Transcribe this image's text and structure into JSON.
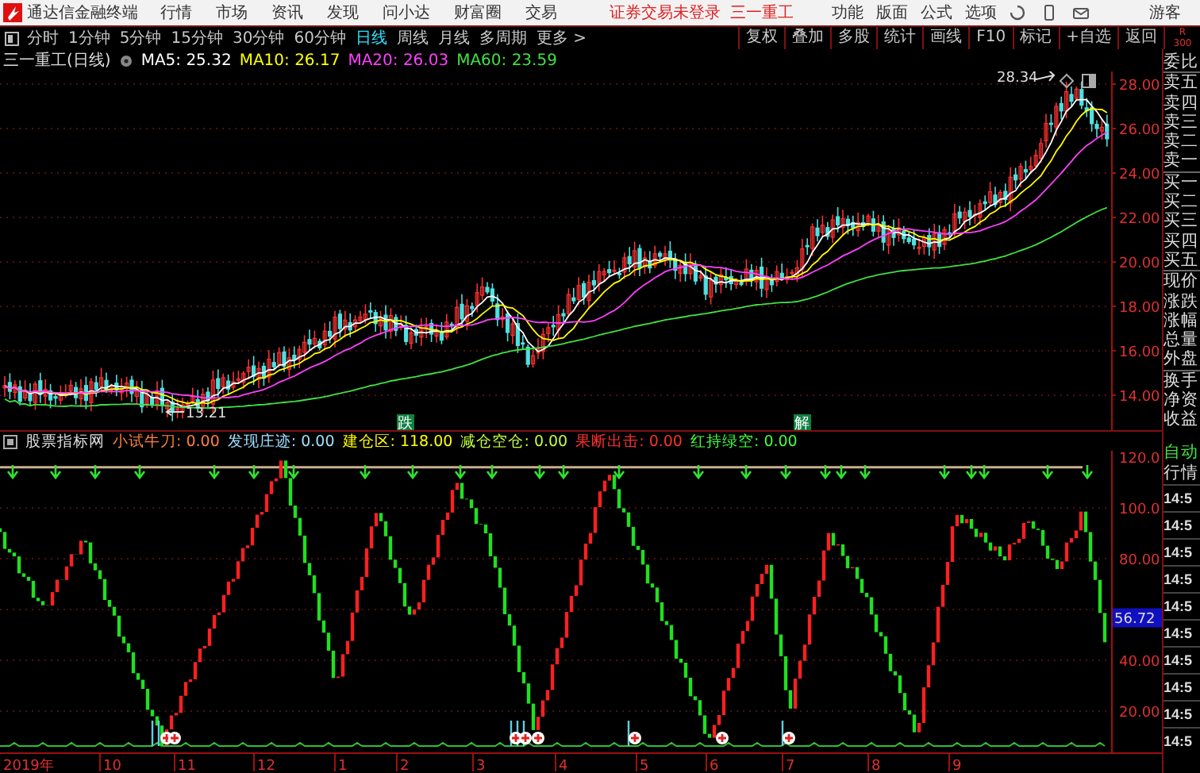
{
  "app": {
    "title": "通达信金融终端",
    "menu": [
      "行情",
      "市场",
      "资讯",
      "发现",
      "问小达",
      "财富圈",
      "交易"
    ],
    "notice": "证券交易未登录",
    "stock": "三一重工",
    "right_menu": [
      "功能",
      "版面",
      "公式",
      "选项"
    ],
    "user": "游客"
  },
  "periods": [
    {
      "label": "分时",
      "selected": false
    },
    {
      "label": "1分钟",
      "selected": false
    },
    {
      "label": "5分钟",
      "selected": false
    },
    {
      "label": "15分钟",
      "selected": false
    },
    {
      "label": "30分钟",
      "selected": false
    },
    {
      "label": "60分钟",
      "selected": false
    },
    {
      "label": "日线",
      "selected": true
    },
    {
      "label": "周线",
      "selected": false
    },
    {
      "label": "月线",
      "selected": false
    },
    {
      "label": "多周期",
      "selected": false
    },
    {
      "label": "更多 >",
      "selected": false
    }
  ],
  "tools": [
    "复权",
    "叠加",
    "多股",
    "统计",
    "画线",
    "F10",
    "标记",
    "+自选",
    "返回"
  ],
  "corner": [
    "R",
    "300"
  ],
  "chart": {
    "title": "三一重工(日线)",
    "ma": [
      {
        "label": "MA5: 25.32",
        "color": "#ffffff"
      },
      {
        "label": "MA10: 26.17",
        "color": "#ffff00"
      },
      {
        "label": "MA20: 26.03",
        "color": "#ff40ff"
      },
      {
        "label": "MA60: 23.59",
        "color": "#40e040"
      }
    ],
    "price_ticks": [
      "28.00",
      "26.00",
      "24.00",
      "22.00",
      "20.00",
      "18.00",
      "16.00",
      "14.00"
    ],
    "high_label": "28.34",
    "low_label": "13.21",
    "event_tags": [
      "跌",
      "解"
    ]
  },
  "indicator": {
    "name": "股票指标网",
    "lines": [
      {
        "label": "小试牛刀: 0.00",
        "color": "#ff8040"
      },
      {
        "label": "发现庄迹: 0.00",
        "color": "#a0e0ff"
      },
      {
        "label": "建仓区: 118.00",
        "color": "#ffff00"
      },
      {
        "label": "减仓空仓: 0.00",
        "color": "#c0ff40"
      },
      {
        "label": "果断出击: 0.00",
        "color": "#ff3030"
      },
      {
        "label": "红持绿空: 0.00",
        "color": "#40ff40"
      }
    ],
    "ticks": [
      "120.0",
      "100.0",
      "80.00",
      "40.00",
      "20.00"
    ],
    "current": "56.72"
  },
  "dates": [
    "2019年",
    "10",
    "11",
    "12",
    "1",
    "2",
    "3",
    "4",
    "5",
    "6",
    "7",
    "8",
    "9"
  ],
  "sidebar": {
    "quote_labels": [
      "委比",
      "卖五",
      "卖四",
      "卖三",
      "卖二",
      "卖一",
      "买一",
      "买二",
      "买三",
      "买四",
      "买五",
      "现价",
      "涨跌",
      "涨幅",
      "总量",
      "外盘",
      "换手",
      "净资",
      "收益"
    ],
    "auto": "自动",
    "tab": "行情",
    "times": [
      "14:5",
      "14:5",
      "14:5",
      "14:5",
      "14:5",
      "14:5",
      "14:5",
      "14:5",
      "14:5",
      "14:5"
    ]
  }
}
